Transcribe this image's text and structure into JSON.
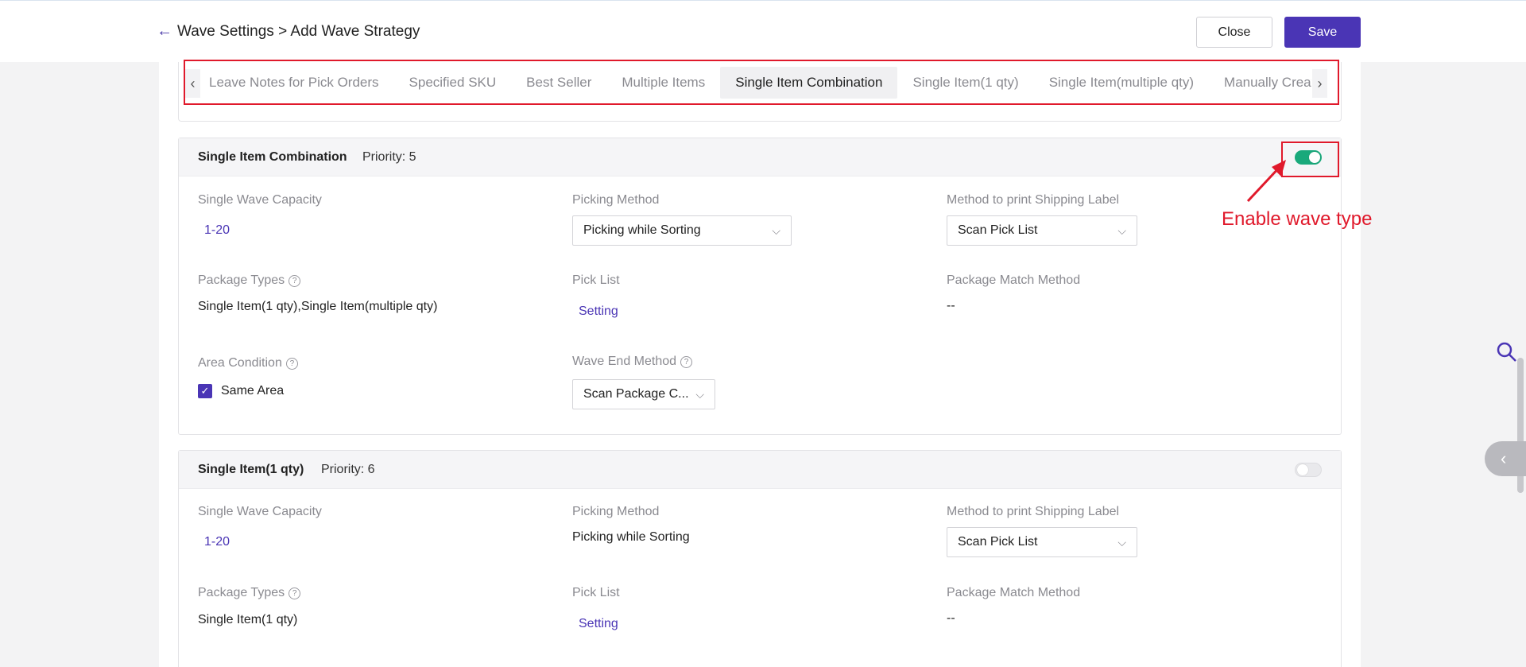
{
  "header": {
    "back_icon": "arrow-left-icon",
    "back_glyph": "←",
    "title": "Wave Settings > Add Wave Strategy",
    "close_label": "Close",
    "save_label": "Save"
  },
  "tabs": {
    "items": [
      "Leave Notes for Pick Orders",
      "Specified SKU",
      "Best Seller",
      "Multiple Items",
      "Single Item Combination",
      "Single Item(1 qty)",
      "Single Item(multiple qty)",
      "Manually Created"
    ],
    "active": "Single Item Combination",
    "prev_glyph": "‹",
    "next_glyph": "›"
  },
  "cards": [
    {
      "name": "Single Item Combination",
      "priority": "Priority: 5",
      "enabled": true,
      "capacity_label": "Single Wave Capacity",
      "capacity_value": "1-20",
      "picking_label": "Picking Method",
      "picking_value": "Picking while Sorting",
      "print_label": "Method to print Shipping Label",
      "print_value": "Scan Pick List",
      "package_types_label": "Package Types",
      "package_types_value": "Single Item(1 qty),Single Item(multiple qty)",
      "pick_list_label": "Pick List",
      "pick_list_value": "Setting",
      "match_label": "Package Match Method",
      "match_value": "--",
      "area_label": "Area Condition",
      "area_value": "Same Area",
      "wave_end_label": "Wave End Method",
      "wave_end_value": "Scan Package C..."
    },
    {
      "name": "Single Item(1 qty)",
      "priority": "Priority: 6",
      "enabled": false,
      "capacity_label": "Single Wave Capacity",
      "capacity_value": "1-20",
      "picking_label": "Picking Method",
      "picking_value": "Picking while Sorting",
      "print_label": "Method to print Shipping Label",
      "print_value": "Scan Pick List",
      "package_types_label": "Package Types",
      "package_types_value": "Single Item(1 qty)",
      "pick_list_label": "Pick List",
      "pick_list_value": "Setting",
      "match_label": "Package Match Method",
      "match_value": "--"
    }
  ],
  "annotation": {
    "text": "Enable wave type",
    "color": "#e0192b"
  },
  "colors": {
    "accent": "#4a35b5",
    "toggle_on": "#19a97b"
  },
  "glyphs": {
    "help": "?",
    "check": "✓",
    "chevron": "⌵",
    "side_collapse": "‹"
  }
}
